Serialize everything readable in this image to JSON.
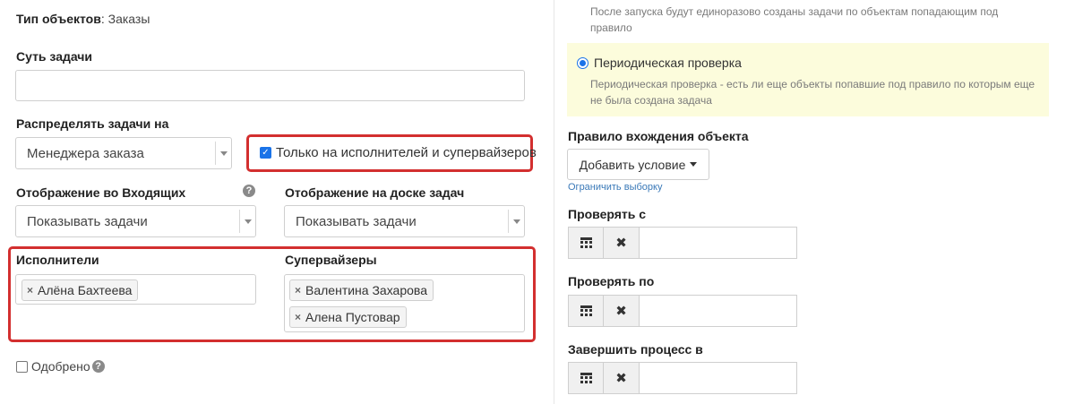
{
  "left": {
    "object_type_label": "Тип объектов",
    "object_type_value": "Заказы",
    "task_essence_label": "Суть задачи",
    "task_essence_value": "",
    "distribute_label": "Распределять задачи на",
    "distribute_value": "Менеджера заказа",
    "only_executors_label": "Только на исполнителей и супервайзеров",
    "only_executors_checked": true,
    "inbox_display_label": "Отображение во Входящих",
    "inbox_display_value": "Показывать задачи",
    "board_display_label": "Отображение на доске задач",
    "board_display_value": "Показывать задачи",
    "executors_label": "Исполнители",
    "executors": [
      "Алёна Бахтеева"
    ],
    "supervisors_label": "Супервайзеры",
    "supervisors": [
      "Валентина Захарова",
      "Алена Пустовар"
    ],
    "approved_label": "Одобрено",
    "approved_checked": false,
    "help_glyph": "?",
    "tag_remove_glyph": "×"
  },
  "right": {
    "one_time_hint": "После запуска будут единоразово созданы задачи по объектам попадающим под правило",
    "periodic_label": "Периодическая проверка",
    "periodic_hint": "Периодическая проверка - есть ли еще объекты попавшие под правило по которым еще не была создана задача",
    "periodic_selected": true,
    "entry_rule_label": "Правило вхождения объекта",
    "add_condition_label": "Добавить условие",
    "limit_selection_link": "Ограничить выборку",
    "check_from_label": "Проверять с",
    "check_to_label": "Проверять по",
    "finish_process_label": "Завершить процесс в",
    "clear_glyph": "✖",
    "check_glyph": "✓"
  },
  "colors": {
    "highlight_border": "#d32f2f",
    "accent": "#1a73e8",
    "periodic_bg": "#fcfcdc",
    "link": "#3a79b8"
  }
}
